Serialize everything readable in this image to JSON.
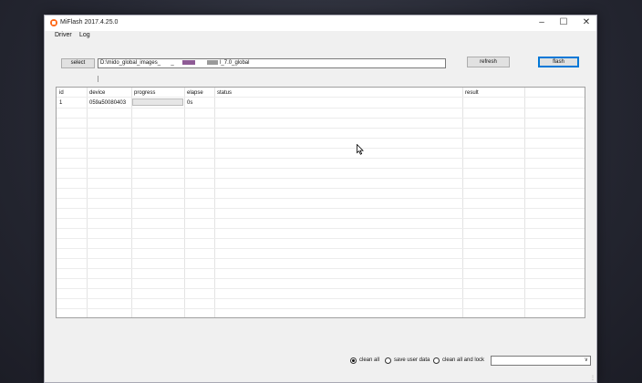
{
  "window": {
    "title": "MiFlash 2017.4.25.0",
    "minimize": "–",
    "maximize": "☐",
    "close": "✕"
  },
  "menu": [
    {
      "label": "Driver"
    },
    {
      "label": "Log"
    }
  ],
  "toolbar": {
    "select_label": "select",
    "path_prefix": "D:\\mido_global_images_",
    "path_mid": "_",
    "path_suffix": "l_7.0_global",
    "refresh_label": "refresh",
    "flash_label": "flash"
  },
  "table": {
    "columns": [
      "id",
      "device",
      "progress",
      "elapse",
      "status",
      "result"
    ],
    "rows": [
      {
        "id": "1",
        "device": "059a50080403",
        "progress": 0,
        "elapse": "0s",
        "status": "",
        "result": ""
      }
    ]
  },
  "options": {
    "clean_all": "clean all",
    "save_user_data": "save user data",
    "clean_all_and_lock": "clean all and lock",
    "selected": "clean_all"
  },
  "colors": {
    "accent": "#0078d7",
    "app_icon": "#ff6a1a",
    "redaction": "#8e5b95"
  }
}
